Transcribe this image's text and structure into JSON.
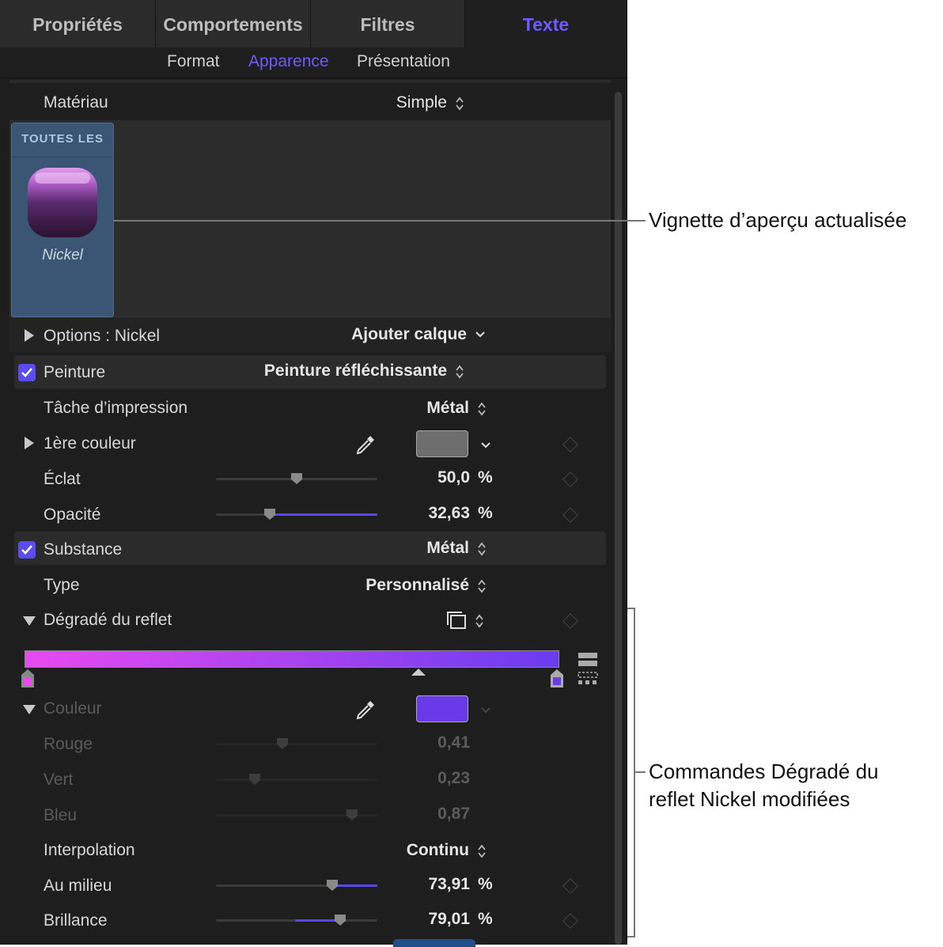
{
  "tabs": [
    "Propriétés",
    "Comportements",
    "Filtres",
    "Texte"
  ],
  "subtabs": [
    "Format",
    "Apparence",
    "Présentation"
  ],
  "material": {
    "label": "Matériau",
    "value": "Simple"
  },
  "preview": {
    "category": "TOUTES LES",
    "name": "Nickel"
  },
  "options": {
    "label": "Options : Nickel",
    "add_layer": "Ajouter calque"
  },
  "paint": {
    "label": "Peinture",
    "value": "Peinture réfléchissante",
    "print_task": {
      "label": "Tâche d’impression",
      "value": "Métal"
    },
    "first_color": {
      "label": "1ère couleur",
      "swatch": "#6e6e6e"
    },
    "eclat": {
      "label": "Éclat",
      "value": "50,0",
      "unit": "%",
      "fraction": 0.5
    },
    "opacity": {
      "label": "Opacité",
      "value": "32,63",
      "unit": "%",
      "fraction": 0.3263
    }
  },
  "substance": {
    "label": "Substance",
    "value": "Métal",
    "type": {
      "label": "Type",
      "value": "Personnalisé"
    },
    "gradient": {
      "label": "Dégradé du reflet",
      "start_color": "#e84af0",
      "end_color": "#6a3cf0"
    },
    "color": {
      "label": "Couleur",
      "swatch": "#6a3ae8",
      "red": {
        "label": "Rouge",
        "value": "0,41"
      },
      "green": {
        "label": "Vert",
        "value": "0,23"
      },
      "blue": {
        "label": "Bleu",
        "value": "0,87"
      }
    },
    "interpolation": {
      "label": "Interpolation",
      "value": "Continu"
    },
    "middle": {
      "label": "Au milieu",
      "value": "73,91",
      "unit": "%",
      "fraction": 0.7391
    },
    "brilliance": {
      "label": "Brillance",
      "value": "79,01",
      "unit": "%",
      "fraction": 0.7901
    }
  },
  "callouts": {
    "preview": "Vignette d’aperçu actualisée",
    "gradient_line1": "Commandes Dégradé du",
    "gradient_line2": "reflet Nickel modifiées"
  },
  "colors": {
    "accent": "#6a5cff",
    "panel_bg": "#1e1e1e",
    "check": "#5a4cf0"
  }
}
